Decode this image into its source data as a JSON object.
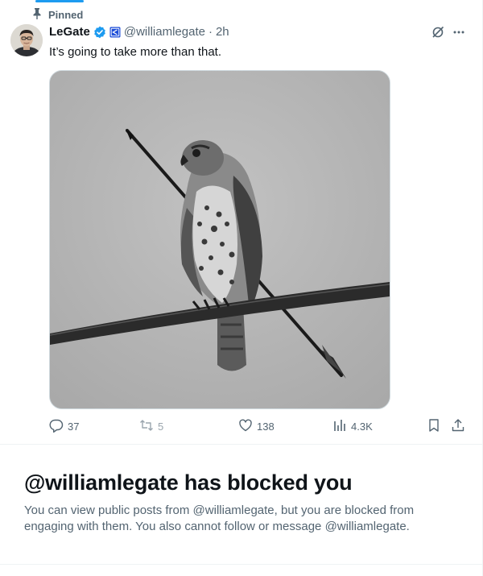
{
  "pinned_label": "Pinned",
  "tweet": {
    "display_name": "LeGate",
    "handle": "@williamlegate",
    "separator": "·",
    "time": "2h",
    "text": "It’s going to take more than that.",
    "image_alt": "Black and white photo of a hawk perched on a wire with an arrow",
    "stats": {
      "replies": "37",
      "reposts": "5",
      "likes": "138",
      "views": "4.3K"
    }
  },
  "blocked": {
    "title": "@williamlegate has blocked you",
    "body": "You can view public posts from @williamlegate, but you are blocked from engaging with them. You also cannot follow or message @williamlegate."
  },
  "icons": {
    "pin": "pin-icon",
    "verified": "verified-badge-icon",
    "affiliate": "affiliate-badge-icon",
    "grok": "grok-icon",
    "more": "more-icon",
    "reply": "reply-icon",
    "repost": "repost-icon",
    "like": "heart-icon",
    "views": "views-icon",
    "bookmark": "bookmark-icon",
    "share": "share-icon"
  },
  "colors": {
    "accent": "#1d9bf0",
    "text_primary": "#0f1419",
    "text_secondary": "#536471",
    "affiliate_badge": "#1d4ed8"
  }
}
